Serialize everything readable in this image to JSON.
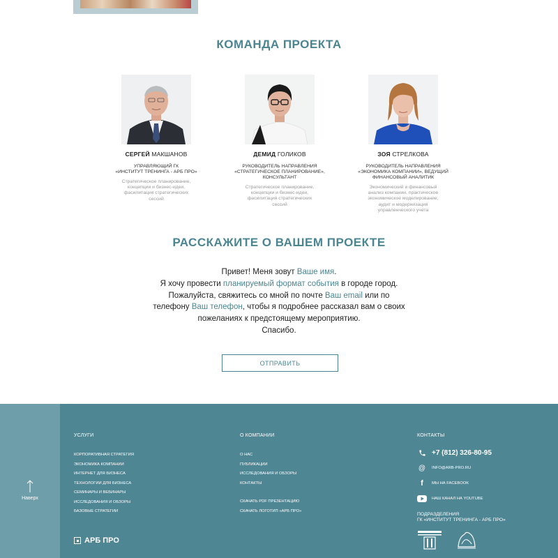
{
  "team": {
    "title": "КОМАНДА ПРОЕКТА",
    "members": [
      {
        "first_name": "СЕРГЕЙ",
        "last_name": "МАКШАНОВ",
        "role_line1": "УПРАВЛЯЮЩИЙ ГК",
        "role_line2": "«ИНСТИТУТ ТРЕНИНГА - АРБ ПРО»",
        "role_line3": "",
        "desc_line1": "Стратегическое планирование,",
        "desc_line2": "концепции и бизнес-идеи,",
        "desc_line3": "фасилитация стратегических",
        "desc_line4": "сессий",
        "desc_line5": ""
      },
      {
        "first_name": "ДЕМИД",
        "last_name": "ГОЛИКОВ",
        "role_line1": "РУКОВОДИТЕЛЬ НАПРАВЛЕНИЯ",
        "role_line2": "«СТРАТЕГИЧЕСКОЕ ПЛАНИРОВАНИЕ»,",
        "role_line3": "КОНСУЛЬТАНТ",
        "desc_line1": "Стратегическое планирование,",
        "desc_line2": "концепции и бизнес-идеи,",
        "desc_line3": "фасилитация стратегических",
        "desc_line4": "сессий",
        "desc_line5": ""
      },
      {
        "first_name": "ЗОЯ",
        "last_name": "СТРЕЛКОВА",
        "role_line1": "РУКОВОДИТЕЛЬ НАПРАВЛЕНИЯ",
        "role_line2": "«ЭКОНОМИКА КОМПАНИИ», ВЕДУЩИЙ",
        "role_line3": "ФИНАНСОВЫЙ АНАЛИТИК",
        "desc_line1": "Экономический и финансовый",
        "desc_line2": "анализ компании, практическое",
        "desc_line3": "экономическое моделирование,",
        "desc_line4": "аудит и модернизация",
        "desc_line5": "управленческого учета"
      }
    ]
  },
  "project": {
    "title": "РАССКАЖИТЕ О ВАШЕМ ПРОЕКТЕ",
    "l1_a": "Привет! Меня зовут ",
    "l1_field": "Ваше имя",
    "l1_b": ".",
    "l2_a": "Я хочу провести ",
    "l2_field": "планируемый формат события",
    "l2_b": " в городе город.",
    "l3_a": "Пожалуйста, свяжитесь со мной по почте ",
    "l3_field": "Ваш email",
    "l3_b": " или по",
    "l4_a": "телефону ",
    "l4_field": "Ваш телефон",
    "l4_b": ", чтобы я подробнее рассказал вам о своих",
    "l5": "пожеланиях к предстоящему мероприятию.",
    "l6": "Спасибо.",
    "send_label": "ОТПРАВИТЬ"
  },
  "footer": {
    "back_top": "Наверх",
    "logo_text": "АРБ ПРО",
    "services": {
      "title": "УСЛУГИ",
      "links": [
        "КОРПОРАТИВНАЯ СТРАТЕГИЯ",
        "ЭКОНОМИКА КОМПАНИИ",
        "ИНТЕРНЕТ ДЛЯ БИЗНЕСА",
        "ТЕХНОЛОГИИ ДЛЯ БИЗНЕСА",
        "СЕМИНАРЫ И ВЕБИНАРЫ",
        "ИССЛЕДОВАНИЯ И ОБЗОРЫ",
        "БАЗОВЫЕ СТРАТЕГИИ"
      ]
    },
    "company": {
      "title": "О КОМПАНИИ",
      "links": [
        "О НАС",
        "ПУБЛИКАЦИИ",
        "ИССЛЕДОВАНИЯ И ОБЗОРЫ",
        "КОНТАКТЫ"
      ],
      "downloads": [
        "СКАЧАТЬ PDF ПРЕЗЕНТАЦИЮ",
        "СКАЧАТЬ ЛОГОТИП «АРБ ПРО»"
      ]
    },
    "contacts": {
      "title": "КОНТАКТЫ",
      "phone": "+7 (812) 326-80-95",
      "email": "INFO@ARB-PRO.RU",
      "facebook": "МЫ НА FACEBOOK",
      "youtube": "НАШ КАНАЛ НА YOUTUBE",
      "divisions_line1": "ПОДРАЗДЕЛЕНИЯ",
      "divisions_line2": "ГК «ИНСТИТУТ ТРЕНИНГА - АРБ ПРО»"
    }
  },
  "colors": {
    "accent": "#4a8592",
    "footer_bg": "#4f8694",
    "footer_left_bg": "#6e9eaa"
  }
}
